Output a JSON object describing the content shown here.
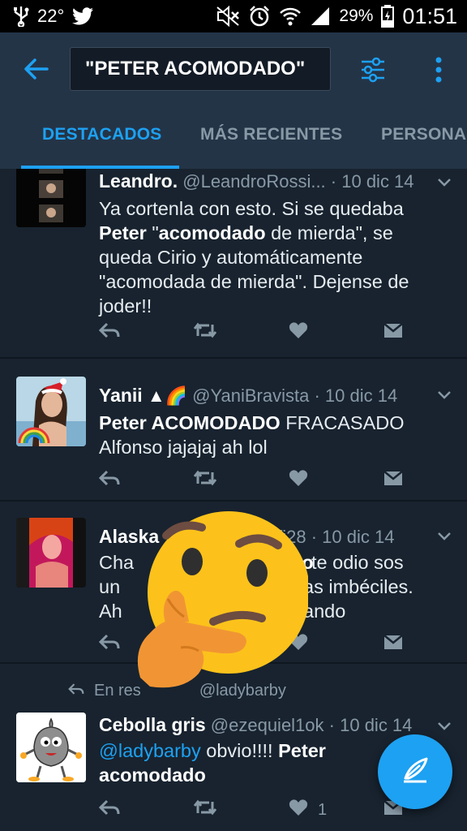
{
  "status_bar": {
    "temperature": "22°",
    "battery": "29%",
    "time": "01:51",
    "icons": [
      "usb-icon",
      "twitter-icon",
      "mute-icon",
      "alarm-icon",
      "wifi-icon",
      "signal-icon",
      "battery-icon"
    ]
  },
  "toolbar": {
    "search_query": "\"PETER ACOMODADO\"",
    "icons": [
      "back-arrow-icon",
      "filter-icon",
      "more-vert-icon"
    ]
  },
  "tabs": [
    {
      "label": "DESTACADOS",
      "active": true
    },
    {
      "label": "MÁS RECIENTES",
      "active": false
    },
    {
      "label": "PERSONAS",
      "active": false
    }
  ],
  "tweets": [
    {
      "name": "Leandro.",
      "handle": "@LeandroRossi...",
      "date": "· 10 dic 14",
      "text_parts": [
        {
          "t": "Ya cortenla con esto. Si se quedaba "
        },
        {
          "t": "Peter",
          "b": true
        },
        {
          "t": " \""
        },
        {
          "t": "acomodado",
          "b": true
        },
        {
          "t": " de mierda\", se queda Cirio y automáticamente \"acomodada de mierda\". Dejense de joder!!"
        }
      ]
    },
    {
      "name": "Yanii",
      "name_suffix": "▲🌈",
      "handle": "@YaniBravista",
      "date": "· 10 dic 14",
      "text_parts": [
        {
          "t": "Peter ACOMODADO",
          "b": true
        },
        {
          "t": " FRACASADO Alfonso jajajaj ah lol"
        }
      ]
    },
    {
      "name": "Alaska",
      "handle": "ffi28",
      "date": "· 10 dic 14",
      "line1a": "Cha",
      "line1b": "do",
      "line1c": " te odio sos",
      "line2a": "un",
      "line2b": "as imbéciles.",
      "line3a": "Ah",
      "line3b": "ando"
    },
    {
      "context_a": "En res",
      "context_b": "@ladybarby",
      "name": "Cebolla gris",
      "handle": "@ezequiel1ok",
      "date": "· 10 dic 14",
      "text_parts": [
        {
          "t": "@ladybarby",
          "m": true
        },
        {
          "t": " obvio!!!! "
        },
        {
          "t": "Peter acomodado",
          "b": true
        }
      ],
      "like_count": "1"
    }
  ],
  "colors": {
    "accent": "#1da1f2",
    "background": "#18232f",
    "toolbar": "#243447",
    "secondary_text": "#8899a6"
  },
  "overlay": {
    "emoji": "thinking-face-emoji"
  }
}
